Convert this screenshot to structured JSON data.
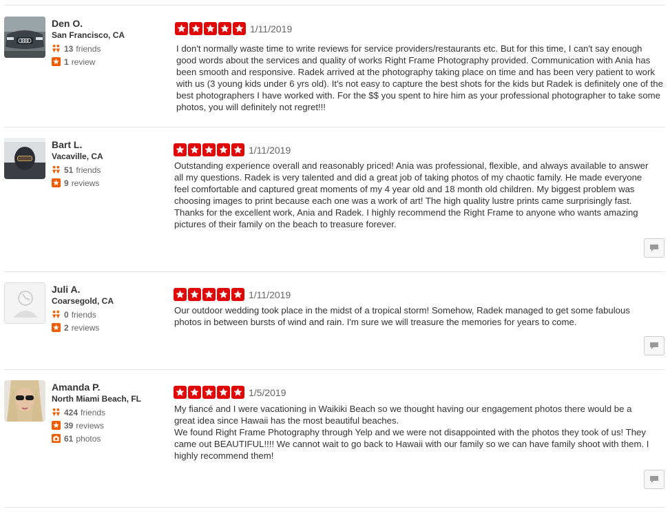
{
  "reviews": [
    {
      "user_name": "Den O.",
      "location": "San Francisco, CA",
      "stats": [
        {
          "icon": "friends-icon",
          "count": "13",
          "label": "friends"
        },
        {
          "icon": "review-star-icon",
          "count": "1",
          "label": "review"
        }
      ],
      "rating": 5,
      "date": "1/11/2019",
      "text": "I don't normally waste time to write reviews for service providers/restaurants etc. But for this time, I can't say enough good words about the services and quality of works Right Frame Photography provided. Communication with Ania has been smooth and responsive. Radek arrived at the photography taking place on time and has been very patient to work with us (3 young kids under 6 yrs old). It's not easy to capture the best shots for the kids but Radek is definitely one of the best photographers I have worked with. For the $$ you spent to hire him as your professional photographer to take some photos, you will definitely not regret!!!",
      "avatar": "car-photo"
    },
    {
      "user_name": "Bart L.",
      "location": "Vacaville, CA",
      "stats": [
        {
          "icon": "friends-icon",
          "count": "51",
          "label": "friends"
        },
        {
          "icon": "review-star-icon",
          "count": "9",
          "label": "reviews"
        }
      ],
      "rating": 5,
      "date": "1/11/2019",
      "text": "Outstanding experience overall and reasonably priced! Ania was professional, flexible, and always available to answer all my questions. Radek is very talented and did a great job of taking photos of my chaotic family. He made everyone feel comfortable and captured great moments of my 4 year old and 18 month old children. My biggest problem was choosing images to print because each one was a work of art! The high quality lustre prints came surprisingly fast. Thanks for the excellent work, Ania and Radek. I highly recommend the Right Frame to anyone who wants amazing pictures of their family on the beach to treasure forever.",
      "avatar": "skier-photo"
    },
    {
      "user_name": "Juli A.",
      "location": "Coarsegold, CA",
      "stats": [
        {
          "icon": "friends-icon",
          "count": "0",
          "label": "friends"
        },
        {
          "icon": "review-star-icon",
          "count": "2",
          "label": "reviews"
        }
      ],
      "rating": 5,
      "date": "1/11/2019",
      "text": "Our outdoor wedding took place in the midst of a tropical storm!  Somehow, Radek managed to get some fabulous photos in between bursts of wind and rain.  I'm sure we will treasure the memories for years to come.",
      "avatar": "default-user"
    },
    {
      "user_name": "Amanda P.",
      "location": "North Miami Beach, FL",
      "stats": [
        {
          "icon": "friends-icon",
          "count": "424",
          "label": "friends"
        },
        {
          "icon": "review-star-icon",
          "count": "39",
          "label": "reviews"
        },
        {
          "icon": "camera-icon",
          "count": "61",
          "label": "photos"
        }
      ],
      "rating": 5,
      "date": "1/5/2019",
      "text": "My fiancé and I were vacationing in Waikiki Beach so we thought having our engagement photos there would be a great idea since Hawaii has the most beautiful beaches.\nWe found Right Frame Photography through Yelp and we were not disappointed with the photos they took of us! They came out BEAUTIFUL!!!! We cannot wait to go back to Hawaii with our family so we can have family shoot with them. I highly recommend them!",
      "avatar": "selfie-photo"
    }
  ],
  "colors": {
    "star_red": "#e00707",
    "stat_orange": "#f15c00",
    "divider": "#e6e6e6"
  }
}
